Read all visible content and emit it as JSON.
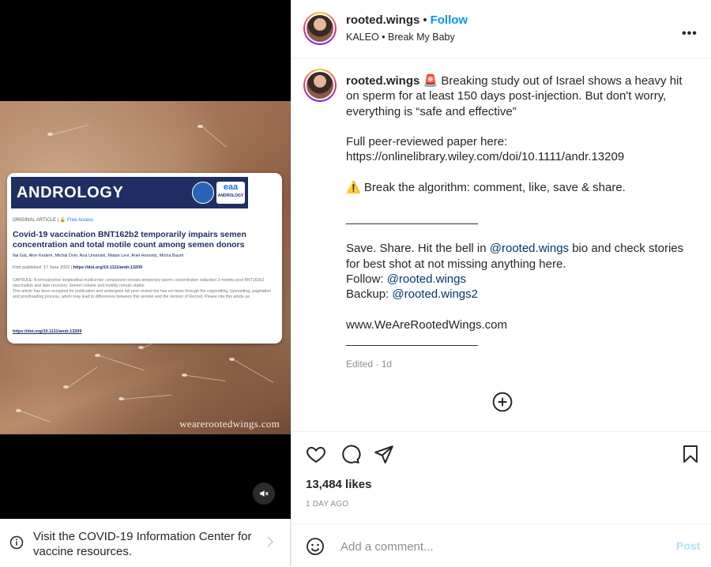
{
  "media": {
    "watermark": "wearerootedwings.com",
    "card": {
      "journal": "ANDROLOGY",
      "logo_small": "ANDROLOGY",
      "logo_big": "eaa",
      "article_type": "ORIGINAL ARTICLE",
      "access": "Free Access",
      "title": "Covid-19 vaccination BNT162b2 temporarily impairs semen concentration and total motile count among semen donors",
      "authors": "Itai Gat, Alon Kedem, Michal Dviri, Ana Umanski, Matan Levi, Ariel Hourvitz, Micha Baum",
      "published_label": "First published: 17 June 2022",
      "doi": "https://doi.org/10.1111/andr.13209",
      "capsule": "CAPSULE: A retrospective longitudinal multicenter comparison reveals temporary sperm concentration reduction 3 months post BNT162b2 vaccination and later recovery. Semen volume and motility remain stable.",
      "note": "This article has been accepted for publication and undergone full peer review but has not been through the copyediting, typesetting, pagination and proofreading process, which may lead to differences between this version and the Version of Record. Please cite this article as",
      "link": "https://doi.org/10.1111/andr.13209"
    }
  },
  "covid_banner": {
    "text": "Visit the COVID-19 Information Center for vaccine resources."
  },
  "header": {
    "username": "rooted.wings",
    "follow_label": "Follow",
    "music": "KALEO • Break My Baby"
  },
  "caption": {
    "username": "rooted.wings",
    "line1": " Breaking study out of Israel shows a heavy hit on sperm for at least 150 days post-injection. But don't worry, everything is “safe and effective”",
    "paper_label": "Full peer-reviewed paper here:",
    "paper_url": "https://onlinelibrary.wiley.com/doi/10.1111/andr.13209",
    "algo": " Break the algorithm: comment, like, save & share.",
    "divider": "____________________",
    "save_pre": "Save. Share. Hit the bell in ",
    "save_mention": "@rooted.wings",
    "save_post": " bio and check stories for best shot at not missing anything here.",
    "follow_pre": "Follow: ",
    "follow_mention": "@rooted.wings",
    "backup_pre": "Backup: ",
    "backup_mention": "@rooted.wings2",
    "site": "www.WeAreRootedWings.com",
    "divider2": "____________________",
    "edited": "Edited · 1d"
  },
  "stats": {
    "likes": "13,484 likes",
    "time_ago": "1 DAY AGO"
  },
  "comment": {
    "placeholder": "Add a comment...",
    "post_label": "Post"
  },
  "icons": [
    "heart-icon",
    "comment-icon",
    "share-icon",
    "bookmark-icon",
    "more-icon",
    "mute-icon",
    "info-icon",
    "chevron-right-icon",
    "emoji-icon",
    "plus-circle-icon",
    "siren-icon",
    "warning-icon"
  ],
  "colors": {
    "accent": "#0095f6",
    "mention": "#00376b",
    "muted": "#8e8e8e",
    "journal_band": "#1f2f63"
  }
}
